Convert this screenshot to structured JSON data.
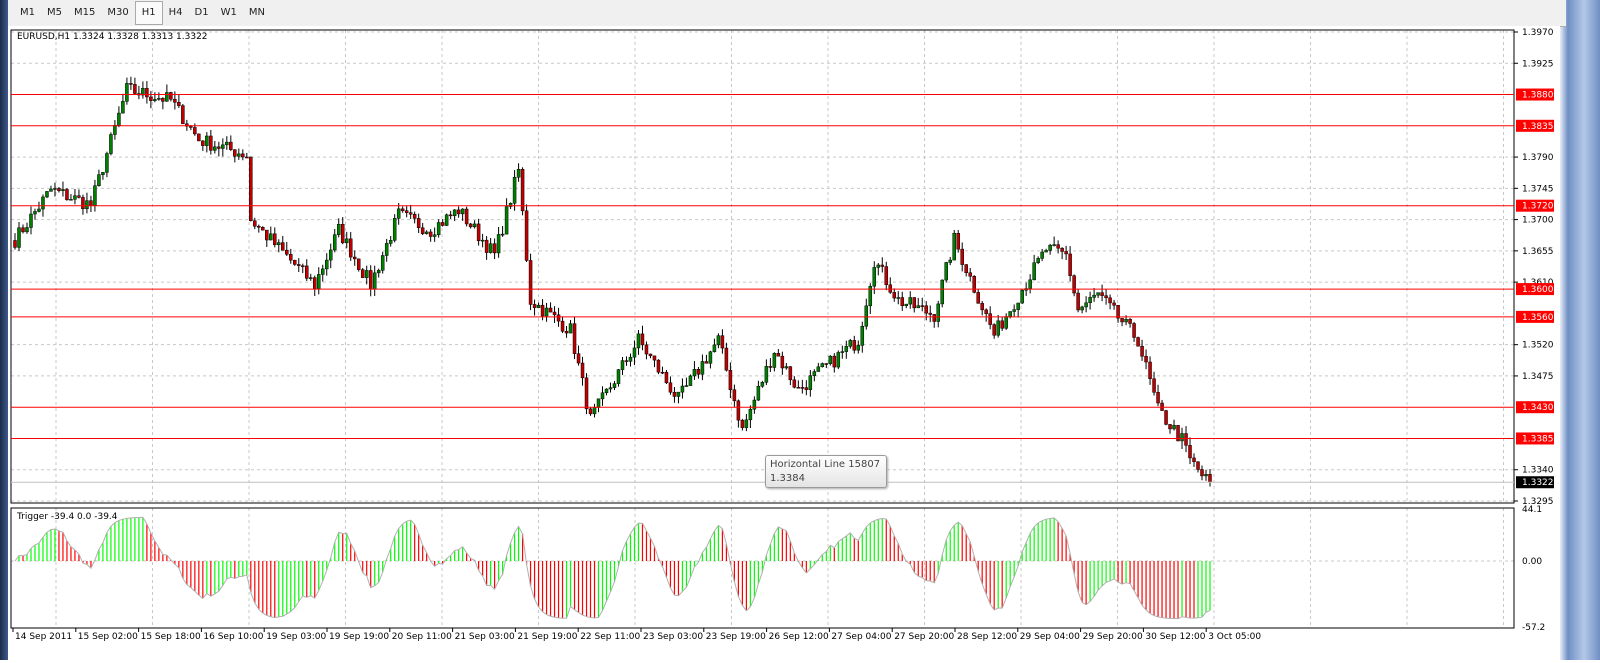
{
  "toolbar": {
    "timeframes": [
      "M1",
      "M5",
      "M15",
      "M30",
      "H1",
      "H4",
      "D1",
      "W1",
      "MN"
    ],
    "active": "H1"
  },
  "header": {
    "ohlc": "EURUSD,H1  1.3324 1.3328 1.3313 1.3322"
  },
  "indicator": {
    "label": "Trigger -39.4 0.0 -39.4",
    "scale": [
      "44.1",
      "0.00",
      "-57.2"
    ],
    "max": 44.1,
    "min": -57.2
  },
  "price_axis": {
    "ticks": [
      "1.3970",
      "1.3925",
      "1.3790",
      "1.3745",
      "1.3700",
      "1.3655",
      "1.3610",
      "1.3520",
      "1.3475",
      "1.3340",
      "1.3295"
    ],
    "max": 1.397,
    "min": 1.3295
  },
  "horizontal_lines": [
    {
      "label": "1.3880",
      "value": 1.388
    },
    {
      "label": "1.3835",
      "value": 1.3835
    },
    {
      "label": "1.3720",
      "value": 1.372
    },
    {
      "label": "1.3600",
      "value": 1.36
    },
    {
      "label": "1.3560",
      "value": 1.356
    },
    {
      "label": "1.3430",
      "value": 1.343
    },
    {
      "label": "1.3385",
      "value": 1.3385
    }
  ],
  "current_price": {
    "label": "1.3322",
    "value": 1.3322
  },
  "tooltip": {
    "title": "Horizontal Line 15807",
    "value": "1.3384"
  },
  "time_axis": [
    "14 Sep 2011",
    "15 Sep 02:00",
    "15 Sep 18:00",
    "16 Sep 10:00",
    "19 Sep 03:00",
    "19 Sep 19:00",
    "20 Sep 11:00",
    "21 Sep 03:00",
    "21 Sep 19:00",
    "22 Sep 11:00",
    "23 Sep 03:00",
    "23 Sep 19:00",
    "26 Sep 12:00",
    "27 Sep 04:00",
    "27 Sep 20:00",
    "28 Sep 12:00",
    "29 Sep 04:00",
    "29 Sep 20:00",
    "30 Sep 12:00",
    "3 Oct 05:00"
  ],
  "colors": {
    "line": "#ff0000",
    "bull": "#008000",
    "bear": "#c00000",
    "ind_up": "#00ff00",
    "ind_down": "#ff0000"
  },
  "chart_data": {
    "type": "candlestick",
    "symbol": "EURUSD",
    "timeframe": "H1",
    "path": [
      [
        0,
        1.3671
      ],
      [
        9,
        1.3743
      ],
      [
        19,
        1.3721
      ],
      [
        28,
        1.3887
      ],
      [
        39,
        1.3872
      ],
      [
        46,
        1.3815
      ],
      [
        58,
        1.3793
      ],
      [
        59,
        1.37
      ],
      [
        75,
        1.3606
      ],
      [
        81,
        1.3685
      ],
      [
        89,
        1.3606
      ],
      [
        96,
        1.3707
      ],
      [
        104,
        1.3685
      ],
      [
        111,
        1.3714
      ],
      [
        120,
        1.3649
      ],
      [
        126,
        1.3771
      ],
      [
        129,
        1.3584
      ],
      [
        139,
        1.3541
      ],
      [
        144,
        1.3412
      ],
      [
        156,
        1.3527
      ],
      [
        166,
        1.3441
      ],
      [
        176,
        1.3527
      ],
      [
        182,
        1.3397
      ],
      [
        190,
        1.3512
      ],
      [
        196,
        1.3455
      ],
      [
        211,
        1.3527
      ],
      [
        215,
        1.3642
      ],
      [
        221,
        1.3584
      ],
      [
        230,
        1.3563
      ],
      [
        235,
        1.3671
      ],
      [
        245,
        1.3534
      ],
      [
        258,
        1.3657
      ],
      [
        263,
        1.3649
      ],
      [
        266,
        1.357
      ],
      [
        271,
        1.3592
      ],
      [
        281,
        1.3527
      ],
      [
        286,
        1.3426
      ],
      [
        292,
        1.3383
      ],
      [
        294,
        1.3354
      ],
      [
        299,
        1.3318
      ]
    ]
  }
}
